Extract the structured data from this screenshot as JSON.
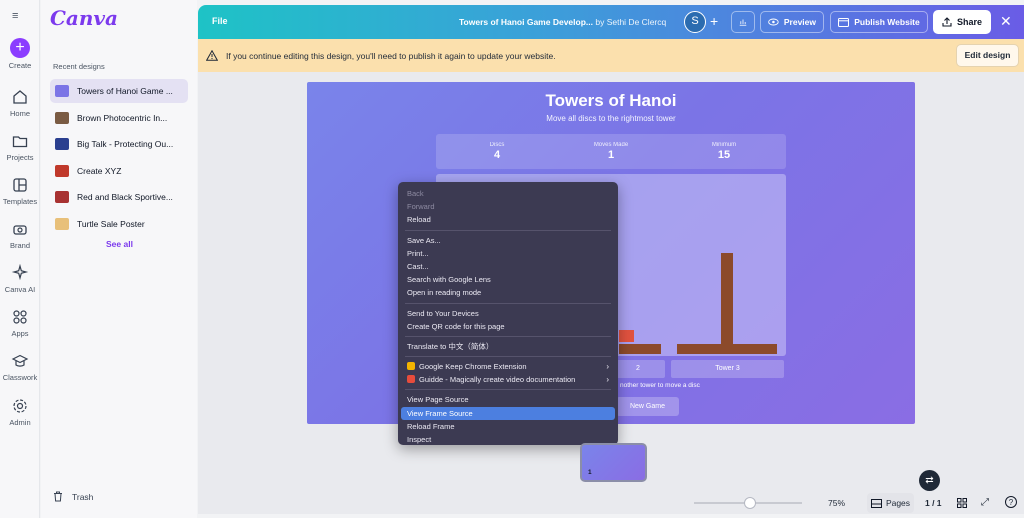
{
  "rail": {
    "items": [
      {
        "label": "Create",
        "icon": "plus-icon"
      },
      {
        "label": "Home",
        "icon": "home-icon"
      },
      {
        "label": "Projects",
        "icon": "folder-icon"
      },
      {
        "label": "Templates",
        "icon": "templates-icon"
      },
      {
        "label": "Brand",
        "icon": "brand-icon"
      },
      {
        "label": "Canva AI",
        "icon": "sparkle-icon"
      },
      {
        "label": "Apps",
        "icon": "apps-icon"
      },
      {
        "label": "Classwork",
        "icon": "classwork-icon"
      },
      {
        "label": "Admin",
        "icon": "gear-icon"
      }
    ]
  },
  "panel": {
    "logo": "Canva",
    "recent_title": "Recent designs",
    "recent": [
      {
        "label": "Towers of Hanoi Game ...",
        "color": "#7b74e6"
      },
      {
        "label": "Brown Photocentric In...",
        "color": "#7a5b43"
      },
      {
        "label": "Big Talk - Protecting Ou...",
        "color": "#2a3f8f"
      },
      {
        "label": "Create XYZ",
        "color": "#c0392b"
      },
      {
        "label": "Red and Black Sportive...",
        "color": "#a83232"
      },
      {
        "label": "Turtle Sale Poster",
        "color": "#e8c07a"
      }
    ],
    "see_all": "See all",
    "trash": "Trash"
  },
  "topbar": {
    "file": "File",
    "title": "Towers of Hanoi Game Develop...",
    "by": "by Sethi De Clercq",
    "avatar": "S",
    "preview": "Preview",
    "publish": "Publish Website",
    "share": "Share"
  },
  "warning": {
    "text": "If you continue editing this design, you'll need to publish it again to update your website.",
    "button": "Edit design"
  },
  "game": {
    "title": "Towers of Hanoi",
    "subtitle": "Move all discs to the rightmost tower",
    "stats": [
      {
        "label": "Discs",
        "value": "4"
      },
      {
        "label": "Moves Made",
        "value": "1"
      },
      {
        "label": "Minimum",
        "value": "15"
      }
    ],
    "tower_labels": [
      "2",
      "Tower 3"
    ],
    "hint": "nother tower to move a disc",
    "new_game": "New Game"
  },
  "context_menu": {
    "groups": [
      [
        {
          "label": "Back",
          "disabled": true
        },
        {
          "label": "Forward",
          "disabled": true
        },
        {
          "label": "Reload",
          "disabled": false
        }
      ],
      [
        {
          "label": "Save As...",
          "disabled": false
        },
        {
          "label": "Print...",
          "disabled": false
        },
        {
          "label": "Cast...",
          "disabled": false
        },
        {
          "label": "Search with Google Lens",
          "disabled": false
        },
        {
          "label": "Open in reading mode",
          "disabled": false
        }
      ],
      [
        {
          "label": "Send to Your Devices",
          "disabled": false
        },
        {
          "label": "Create QR code for this page",
          "disabled": false
        }
      ],
      [
        {
          "label": "Translate to 中文（简体）",
          "disabled": false
        }
      ],
      [
        {
          "label": "Google Keep Chrome Extension",
          "submenu": true,
          "icon_color": "#f4b400"
        },
        {
          "label": "Guidde - Magically create video documentation",
          "submenu": true,
          "icon_color": "#e74c3c"
        }
      ],
      [
        {
          "label": "View Page Source",
          "disabled": false
        },
        {
          "label": "View Frame Source",
          "highlighted": true
        },
        {
          "label": "Reload Frame",
          "disabled": false
        },
        {
          "label": "Inspect",
          "disabled": false
        }
      ]
    ]
  },
  "page_thumb": {
    "number": "1"
  },
  "bottom": {
    "zoom": "75%",
    "zoom_fraction": 0.52,
    "pages": "Pages",
    "page_count": "1 / 1"
  }
}
